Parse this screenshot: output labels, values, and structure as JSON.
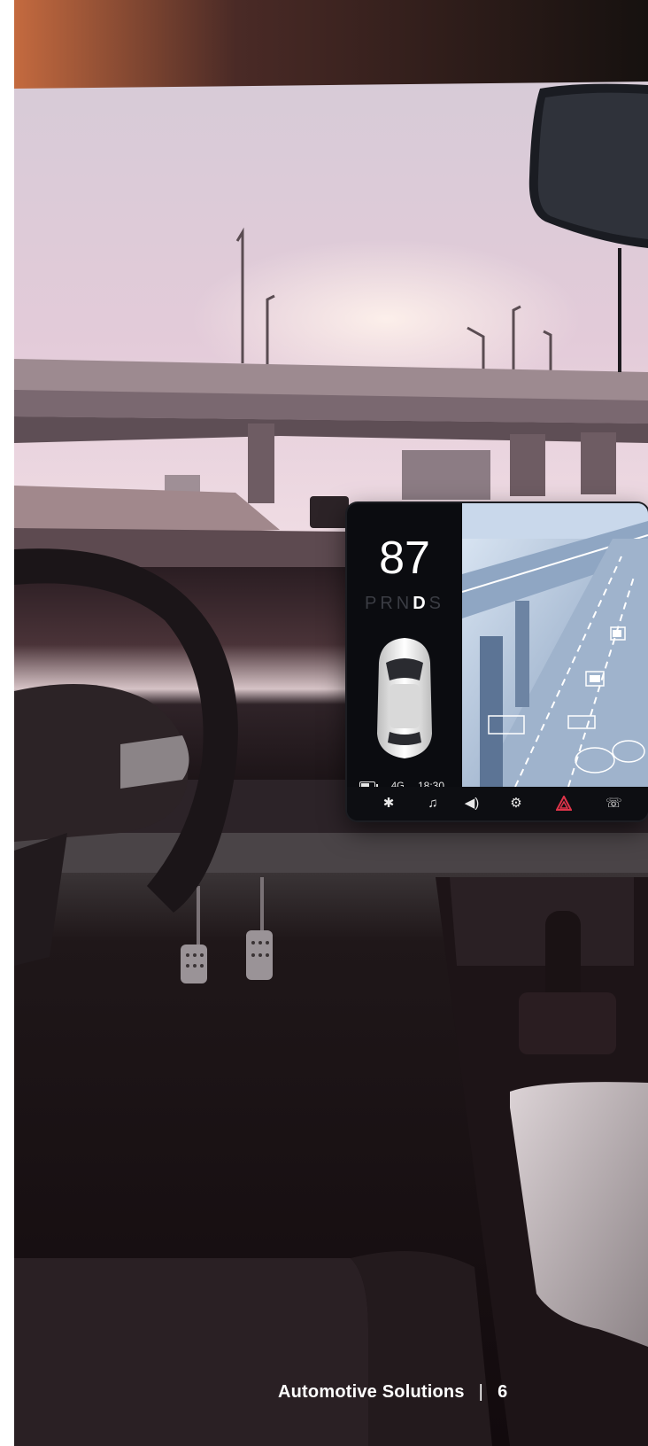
{
  "footer": {
    "title": "Automotive Solutions",
    "separator": "|",
    "page_number": "6"
  },
  "display": {
    "speed": "87",
    "gears": [
      "P",
      "R",
      "N",
      "D",
      "S"
    ],
    "active_gear": "D",
    "status": {
      "network": "4G",
      "time": "18:30",
      "battery_level": 0.7
    },
    "dock_icons": [
      "fan-icon",
      "music-icon",
      "volume-icon",
      "settings-icon",
      "hazard-icon",
      "phone-icon"
    ]
  },
  "colors": {
    "hazard": "#e0344a",
    "screen_tint": "#a9c4e6"
  }
}
